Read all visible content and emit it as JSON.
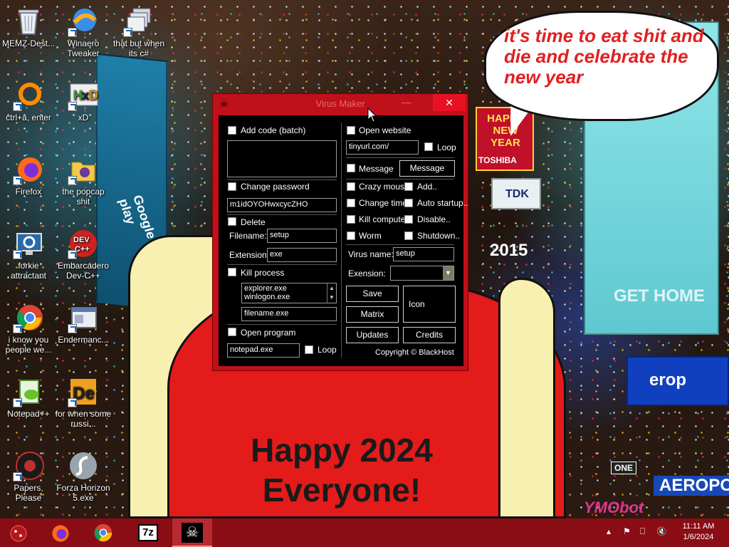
{
  "desktop": {
    "icons": [
      {
        "label": "MEMZ-Dest...",
        "icon": "recycle-bin-icon"
      },
      {
        "label": "Winaero Tweaker",
        "icon": "winaero-icon"
      },
      {
        "label": "that but when its c#",
        "icon": "stacked-windows-icon"
      },
      {
        "label": "ctrl+a, enter",
        "icon": "orange-ring-icon"
      },
      {
        "label": "xD",
        "icon": "hxd-icon"
      },
      {
        "label": "Firefox",
        "icon": "firefox-icon"
      },
      {
        "label": "the popcap shit",
        "icon": "popcap-folder-icon"
      },
      {
        "label": "forkie attractant",
        "icon": "settings-monitor-icon"
      },
      {
        "label": "Embarcadero Dev-C++",
        "icon": "devcpp-icon"
      },
      {
        "label": "i know you people we...",
        "icon": "chrome-icon"
      },
      {
        "label": "Endermanc...",
        "icon": "window-app-icon"
      },
      {
        "label": "Notepad++",
        "icon": "notepadpp-icon"
      },
      {
        "label": "for when some russi...",
        "icon": "de-icon"
      },
      {
        "label": "Papers, Please",
        "icon": "papers-please-icon"
      },
      {
        "label": "Forza Horizon 5.exe",
        "icon": "flash-icon"
      }
    ]
  },
  "wallpaper": {
    "speech_bubble": "it's time to eat shit and die and celebrate the new year",
    "shirt_text_line1": "Happy 2024",
    "shirt_text_line2": "Everyone!",
    "billboard_happy": "HAPPY NEW YEAR",
    "billboard_tdk": "TDK",
    "billboard_2015": "2015",
    "billboard_toshiba": "TOSHIBA",
    "billboard_google": "Google play",
    "billboard_gethome": "GET HOME",
    "billboard_europa": "erop",
    "billboard_aeropos": "AEROPOS",
    "billboard_one": "ONE",
    "watermark": "YMObot"
  },
  "window": {
    "title": "Virus Maker",
    "minimize": "—",
    "close": "✕",
    "add_code_label": "Add code (batch)",
    "add_code_value": "",
    "change_password_label": "Change password",
    "password_value": "m1idOYOHwxcycZHO",
    "delete_label": "Delete",
    "filename_label": "Filename:",
    "filename_value": "setup",
    "extension_label": "Extension:",
    "extension_value": "exe",
    "kill_process_label": "Kill process",
    "process_list": [
      "explorer.exe",
      "winlogon.exe"
    ],
    "process_filename_value": "filename.exe",
    "open_program_label": "Open program",
    "program_value": "notepad.exe",
    "program_loop_label": "Loop",
    "open_website_label": "Open website",
    "website_value": "tinyurl.com/",
    "website_loop_label": "Loop",
    "message_label": "Message",
    "message_button": "Message",
    "crazy_mouse_label": "Crazy mouse",
    "add_label": "Add..",
    "change_time_label": "Change time",
    "auto_startup_label": "Auto startup..",
    "kill_computer_label": "Kill computer",
    "disable_label": "Disable..",
    "worm_label": "Worm",
    "shutdown_label": "Shutdown..",
    "virus_name_label": "Virus name:",
    "virus_name_value": "setup",
    "exension_label": "Exension:",
    "exension_value": "",
    "save_button": "Save",
    "matrix_button": "Matrix",
    "updates_button": "Updates",
    "icon_button": "Icon",
    "credits_button": "Credits",
    "copyright": "Copyright © BlackHost"
  },
  "taskbar": {
    "time": "11:11 AM",
    "date": "1/6/2024",
    "sevenzip_label": "7z",
    "tray_chevron": "▴",
    "tray_flag": "⚑",
    "tray_network": "⎕",
    "tray_volume": "🔇"
  },
  "colors": {
    "taskbar": "#8a0c15",
    "window_frame": "#c0101a",
    "close_button": "#e81123",
    "bubble_text": "#e02020",
    "shirt": "#e41b1b"
  }
}
